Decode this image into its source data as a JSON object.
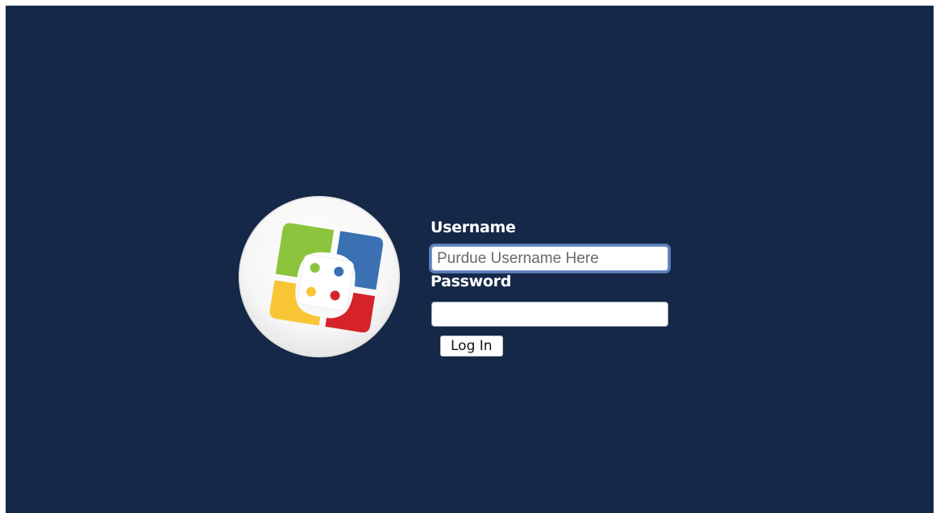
{
  "login": {
    "username_label": "Username",
    "username_placeholder": "Purdue Username Here",
    "username_value": "",
    "password_label": "Password",
    "password_value": "",
    "submit_label": "Log In"
  },
  "logo": {
    "icon": "casper-suite-logo-icon",
    "colors": {
      "green": "#8cc43e",
      "blue": "#3a71b3",
      "yellow": "#f8c534",
      "red": "#d52329"
    }
  },
  "theme": {
    "background": "#162848",
    "focus_ring": "#5b7db8"
  }
}
